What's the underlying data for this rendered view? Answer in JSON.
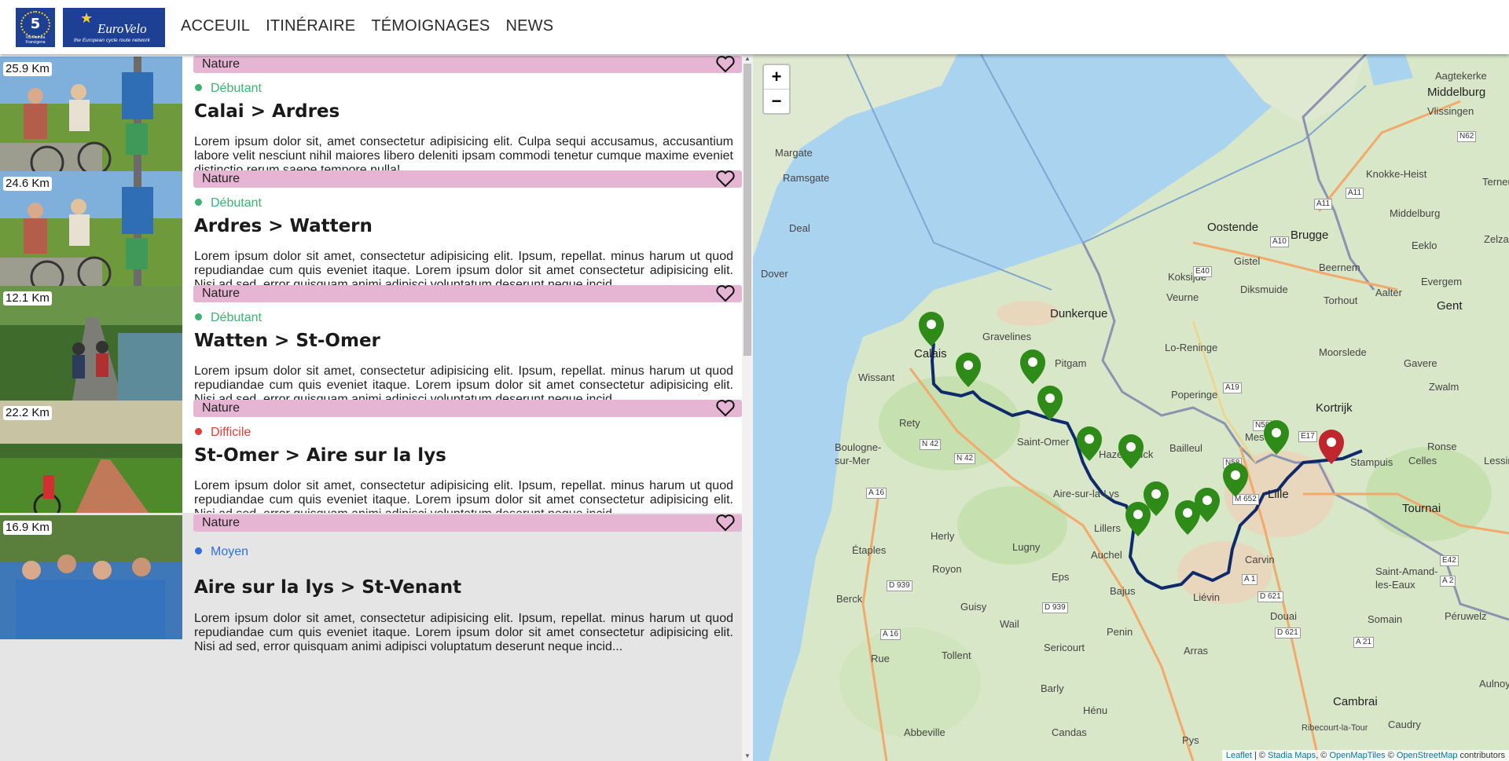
{
  "header": {
    "logo5": {
      "number": "5",
      "subtitle": "Via Romea Francigena"
    },
    "logoEV": {
      "name": "EuroVelo",
      "tagline": "the European cycle route network"
    },
    "nav": [
      "ACCEUIL",
      "ITINÉRAIRE",
      "TÉMOIGNAGES",
      "NEWS"
    ]
  },
  "colors": {
    "tag": "#e5b5d3",
    "debutant": "#3cb371",
    "difficile": "#e0403a",
    "moyen": "#2f6fe0",
    "route": "#0f2a6b",
    "marker_green": "#2e8b17",
    "marker_red": "#c0262d"
  },
  "stages": [
    {
      "distance": "25.9 Km",
      "tag": "Nature",
      "difficulty": "Débutant",
      "level": "debutant",
      "title": "Calai > Ardres",
      "description": "Lorem ipsum dolor sit, amet consectetur adipisicing elit. Culpa sequi accusamus, accusantium labore velit nesciunt nihil maiores libero deleniti ipsam commodi tenetur cumque maxime eveniet distinctio rerum saepe tempore nulla!..."
    },
    {
      "distance": "24.6 Km",
      "tag": "Nature",
      "difficulty": "Débutant",
      "level": "debutant",
      "title": "Ardres > Wattern",
      "description": "Lorem ipsum dolor sit amet, consectetur adipisicing elit. Ipsum, repellat. minus harum ut quod repudiandae cum quis eveniet itaque. Lorem ipsum dolor sit amet consectetur adipisicing elit. Nisi ad sed, error quisquam animi adipisci voluptatum deserunt neque incid..."
    },
    {
      "distance": "12.1 Km",
      "tag": "Nature",
      "difficulty": "Débutant",
      "level": "debutant",
      "title": "Watten > St-Omer",
      "description": "Lorem ipsum dolor sit amet, consectetur adipisicing elit. Ipsum, repellat. minus harum ut quod repudiandae cum quis eveniet itaque. Lorem ipsum dolor sit amet consectetur adipisicing elit. Nisi ad sed, error quisquam animi adipisci voluptatum deserunt neque incid..."
    },
    {
      "distance": "22.2 Km",
      "tag": "Nature",
      "difficulty": "Difficile",
      "level": "difficile",
      "title": "St-Omer > Aire sur la lys",
      "description": "Lorem ipsum dolor sit amet, consectetur adipisicing elit. Ipsum, repellat. minus harum ut quod repudiandae cum quis eveniet itaque. Lorem ipsum dolor sit amet consectetur adipisicing elit. Nisi ad sed, error quisquam animi adipisci voluptatum deserunt neque incid..."
    },
    {
      "distance": "16.9 Km",
      "tag": "Nature",
      "difficulty": "Moyen",
      "level": "moyen",
      "title": "Aire sur la lys > St-Venant",
      "description": "Lorem ipsum dolor sit amet, consectetur adipisicing elit. Ipsum, repellat. minus harum ut quod repudiandae cum quis eveniet itaque. Lorem ipsum dolor sit amet consectetur adipisicing elit. Nisi ad sed, error quisquam animi adipisci voluptatum deserunt neque incid..."
    }
  ],
  "map": {
    "zoom_in": "+",
    "zoom_out": "−",
    "attribution": {
      "leaflet": "Leaflet",
      "sep1": " | © ",
      "stadia": "Stadia Maps",
      "sep2": ", © ",
      "omt": "OpenMapTiles",
      "sep3": " © ",
      "osm": "OpenStreetMap",
      "tail": " contributors"
    },
    "places": [
      "Aagtekerke",
      "Middelburg",
      "Vlissingen",
      "Margate",
      "Ramsgate",
      "Knokke-Heist",
      "Middelburg",
      "Terneu",
      "Deal",
      "Oostende",
      "Brugge",
      "Eeklo",
      "Zelzate",
      "Dover",
      "Gistel",
      "Beernem",
      "Evergem",
      "Koksijde",
      "Veurne",
      "Diksmuide",
      "Torhout",
      "Aalter",
      "Gent",
      "Dunkerque",
      "Gravelines",
      "Calais",
      "Lo-Reninge",
      "Wissant",
      "Pitgam",
      "Moorslede",
      "Gavere",
      "Poperinge",
      "Kortrijk",
      "Zwalm",
      "Rety",
      "Saint-Omer",
      "Hazebrouck",
      "Bailleul",
      "Mesen",
      "Boulogne-sur-Mer",
      "Ronse",
      "Stampuis",
      "Celles",
      "Lessine",
      "Aire-sur-la-Lys",
      "Lille",
      "Tournai",
      "Lillers",
      "Herly",
      "Lugny",
      "Étaples",
      "Auchel",
      "Carvin",
      "Royon",
      "Eps",
      "Saint-Amand-les-Eaux",
      "Berck",
      "Bajus",
      "Liévin",
      "Guisy",
      "Douai",
      "Somain",
      "Wail",
      "Penin",
      "Péruwelz",
      "Rue",
      "Tollent",
      "Sericourt",
      "Arras",
      "Cambrai",
      "Barly",
      "Hénu",
      "Abbeville",
      "Candas",
      "Caudry",
      "Ribecourt-la-Tour",
      "Aulnoy",
      "Pys"
    ],
    "roads": [
      "A11",
      "A11",
      "N62",
      "A10",
      "E40",
      "A19",
      "N58",
      "E17",
      "N58",
      "M 652",
      "N 42",
      "N 42",
      "A 16",
      "A 16",
      "A 21",
      "D 939",
      "D 939",
      "D 621",
      "D 621",
      "A 1",
      "E42",
      "A 2"
    ]
  }
}
